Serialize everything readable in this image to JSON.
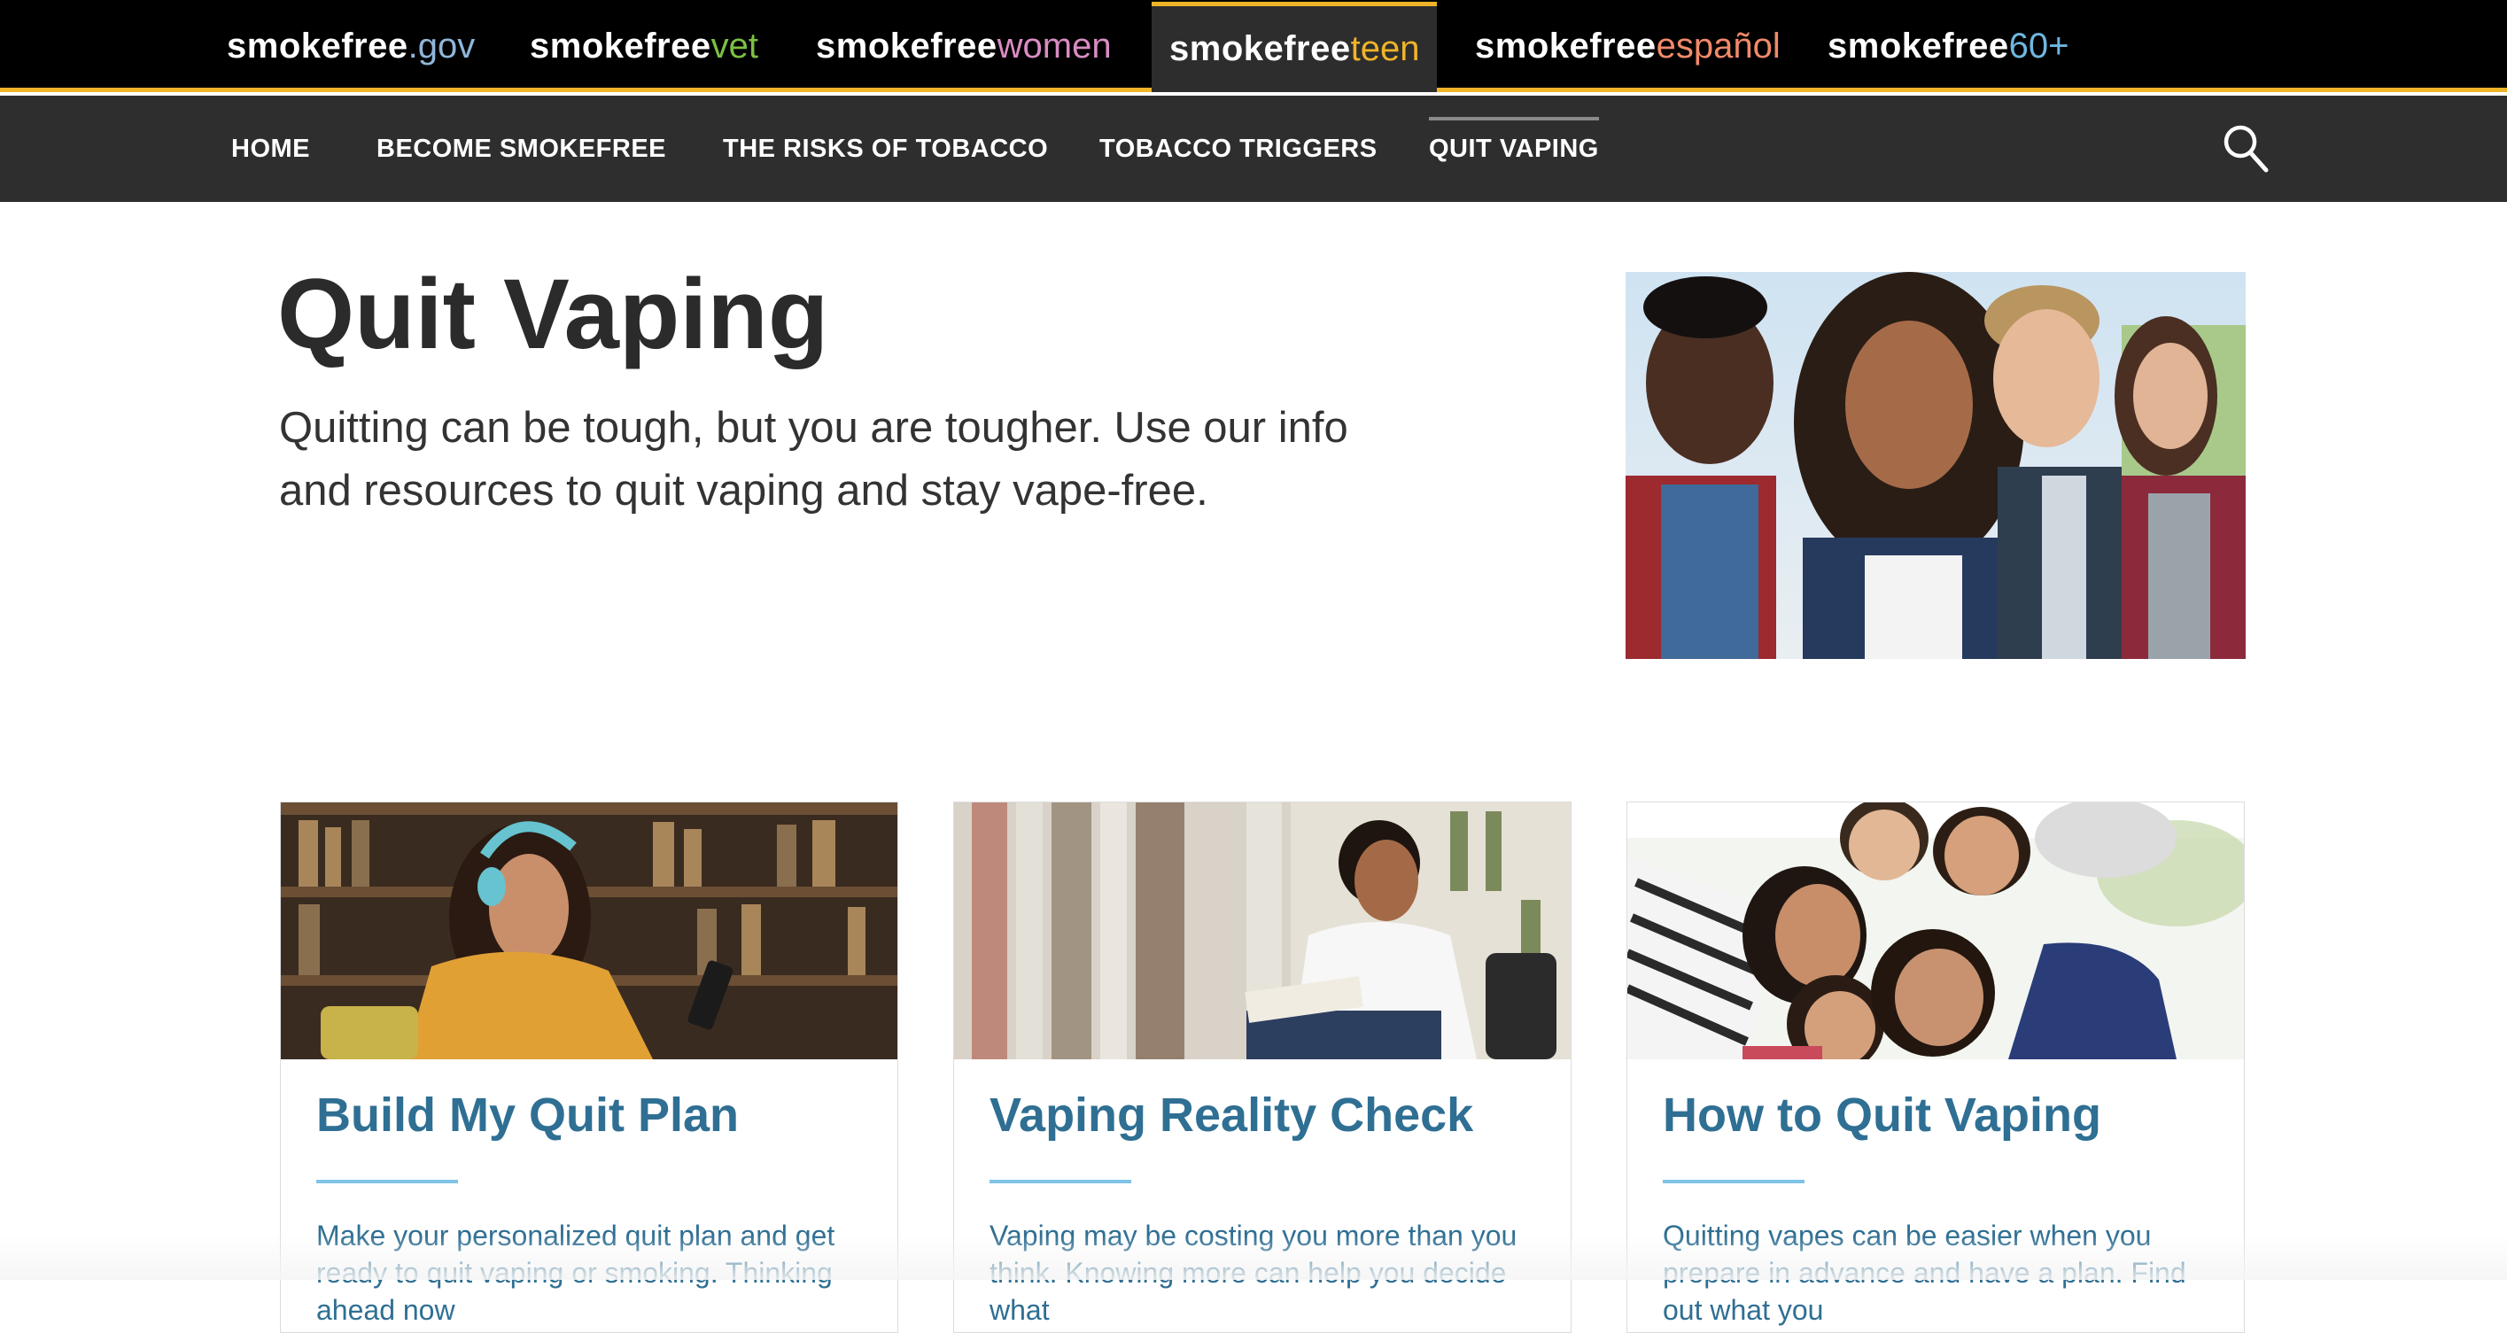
{
  "site_switcher": [
    {
      "bold": "smokefree",
      "suffix": ".gov",
      "suffix_color": "#8fb6d9"
    },
    {
      "bold": "smokefree",
      "suffix": "vet",
      "suffix_color": "#7bc043"
    },
    {
      "bold": "smokefree",
      "suffix": "women",
      "suffix_color": "#d98cc4"
    },
    {
      "bold": "smokefree",
      "suffix": "teen",
      "suffix_color": "#f0b429"
    },
    {
      "bold": "smokefree",
      "suffix": "español",
      "suffix_color": "#f08a6a"
    },
    {
      "bold": "smokefree",
      "suffix": "60+",
      "suffix_color": "#6fb7e0"
    }
  ],
  "active_site": "smokefreeteen",
  "nav": {
    "items": [
      "HOME",
      "BECOME SMOKEFREE",
      "THE RISKS OF TOBACCO",
      "TOBACCO TRIGGERS",
      "QUIT VAPING"
    ],
    "active": "QUIT VAPING",
    "search_icon": "search-icon"
  },
  "hero": {
    "title": "Quit Vaping",
    "subtitle": "Quitting can be tough, but you are tougher. Use our info and resources to quit vaping and stay vape-free."
  },
  "cards": [
    {
      "title": "Build My Quit Plan",
      "text": "Make your personalized quit plan and get ready to quit vaping or smoking. Thinking ahead now"
    },
    {
      "title": "Vaping Reality Check",
      "text": "Vaping may be costing you more than you think. Knowing more can help you decide what"
    },
    {
      "title": "How to Quit Vaping",
      "text": "Quitting vapes can be easier when you prepare in advance and have a plan. Find out what you"
    }
  ],
  "colors": {
    "accent": "#f0b429",
    "link": "#2f6f93",
    "rule": "#7fc3e6",
    "nav_bg": "#2e2e2e"
  }
}
